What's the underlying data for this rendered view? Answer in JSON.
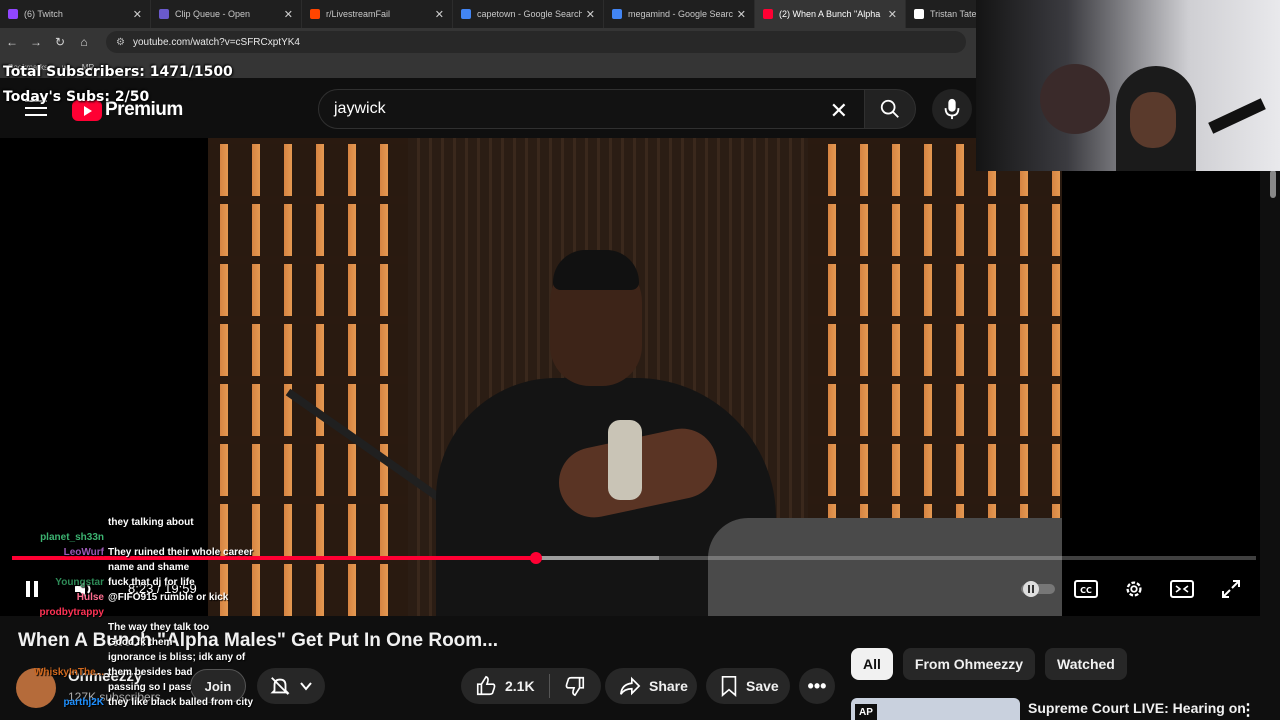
{
  "browser": {
    "tabs": [
      {
        "label": "(6) Twitch",
        "favicon": "twitch-favicon",
        "color": "#9146ff",
        "active": false
      },
      {
        "label": "Clip Queue - Open",
        "favicon": "clipqueue-favicon",
        "color": "#6a5acd",
        "active": false
      },
      {
        "label": "r/LivestreamFail",
        "favicon": "reddit-favicon",
        "color": "#ff4500",
        "active": false
      },
      {
        "label": "capetown - Google Search",
        "favicon": "google-favicon",
        "color": "#4285f4",
        "active": false
      },
      {
        "label": "megamind - Google Search",
        "favicon": "google-favicon",
        "color": "#4285f4",
        "active": false
      },
      {
        "label": "(2) When A Bunch \"Alpha",
        "favicon": "youtube-favicon",
        "color": "#ff0033",
        "active": true
      },
      {
        "label": "Tristan Tate",
        "favicon": "x-favicon",
        "color": "#ffffff",
        "active": false
      }
    ],
    "url": "youtube.com/watch?v=cSFRCxptYK4",
    "bookmarks": [
      "Bookmarks",
      "w",
      "MR"
    ]
  },
  "stream_overlay": {
    "total_subs": "Total Subscribers: 1471/1500",
    "today_subs": "Today's Subs: 2/50"
  },
  "youtube": {
    "logo_text": "Premium",
    "search_value": "jaywick",
    "player": {
      "time": "8:23 / 19:59",
      "progress_played": 0.421,
      "progress_loaded": 0.52
    },
    "video_title": "When A Bunch \"Alpha Males\" Get Put In One Room...",
    "channel": {
      "name": "Ohmeezzy",
      "subs": "127K subscribers",
      "join_label": "Join"
    },
    "actions": {
      "likes": "2.1K",
      "share_label": "Share",
      "save_label": "Save"
    },
    "chips": [
      "All",
      "From Ohmeezzy",
      "Watched"
    ],
    "recommendation": {
      "title": "Supreme Court LIVE: Hearing on",
      "badge": "AP"
    }
  },
  "chat": [
    {
      "user": "",
      "text": "they talking about",
      "color": "#5bc0de"
    },
    {
      "user": "planet_sh33n",
      "text": "",
      "color": "#3cb371"
    },
    {
      "user": "LeoWurf",
      "text": "They ruined their whole career",
      "color": "#9b59b6"
    },
    {
      "user": "",
      "text": "name and shame",
      "color": "#ffffff"
    },
    {
      "user": "Youngstar",
      "text": "fuck that dj for life",
      "color": "#2e8b57"
    },
    {
      "user": "Hulse",
      "text": "@FIFO915 rumble or kick",
      "color": "#ff6f91"
    },
    {
      "user": "prodbytrappy",
      "text": "",
      "color": "#ff3355"
    },
    {
      "user": "",
      "text": "The way they talk too",
      "color": "#ff3355"
    },
    {
      "user": "",
      "text": "Good fk them",
      "color": "#1e90ff"
    },
    {
      "user": "",
      "text": "ignorance is bliss; idk any of",
      "color": "#1e90ff"
    },
    {
      "user": "WhiskyInThe...",
      "text": "them besides bad",
      "color": "#d2691e"
    },
    {
      "user": "",
      "text": "passing so I pass",
      "color": "#d2691e"
    },
    {
      "user": "parthj2K",
      "text": "they like black balled from city",
      "color": "#1e90ff"
    }
  ]
}
